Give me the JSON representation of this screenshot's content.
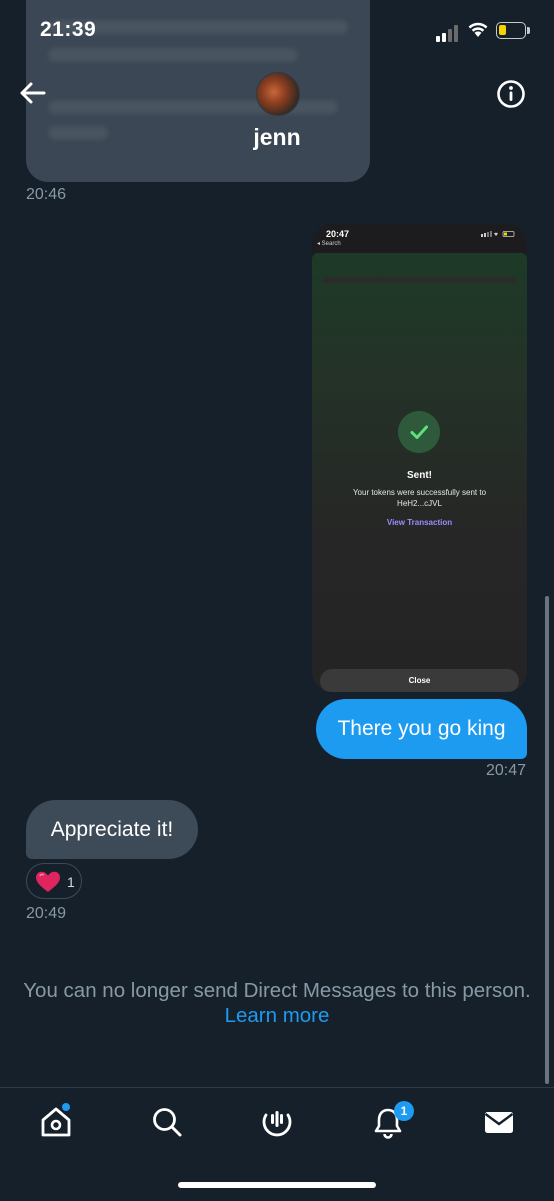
{
  "status_bar": {
    "time": "21:39"
  },
  "header": {
    "contact_name": "jenn",
    "back_icon": "arrow-left-icon",
    "info_icon": "info-icon"
  },
  "messages": {
    "ts_first": "20:46",
    "attachment": {
      "status_time": "20:47",
      "back_label": "◂ Search",
      "title": "Sent!",
      "line1": "Your tokens were successfully sent to",
      "line2": "HeH2...cJVL",
      "link": "View Transaction",
      "close_label": "Close"
    },
    "outgoing_text": "There you go king",
    "outgoing_time": "20:47",
    "incoming_text": "Appreciate it!",
    "reaction": {
      "emoji": "heart",
      "count": "1"
    },
    "incoming_time": "20:49"
  },
  "notice": {
    "text": "You can no longer send Direct Messages to this person.",
    "link": "Learn more"
  },
  "tabbar": {
    "items": [
      "home-icon",
      "search-icon",
      "spaces-icon",
      "notifications-icon",
      "messages-icon"
    ],
    "notifications_badge": "1"
  },
  "colors": {
    "background": "#15202b",
    "accent": "#1d9bf0",
    "incoming_bubble": "#3d4a57"
  }
}
